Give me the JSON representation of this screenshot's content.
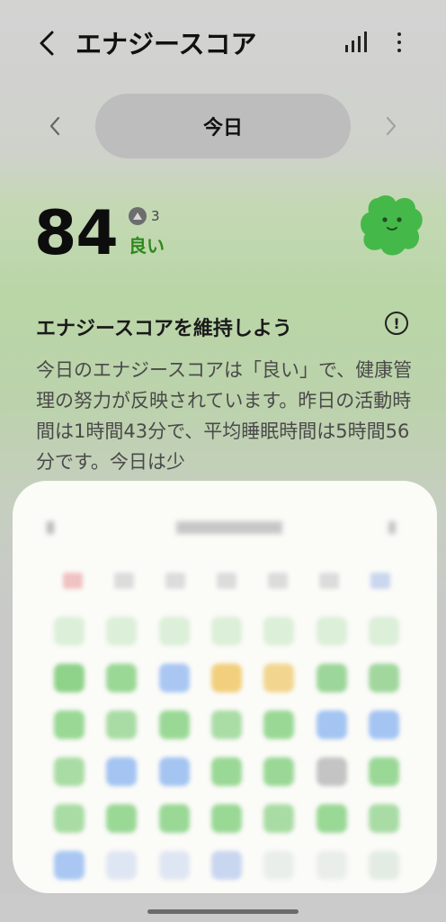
{
  "header": {
    "title": "エナジースコア"
  },
  "date_nav": {
    "label": "今日"
  },
  "score": {
    "value": "84",
    "delta": "3",
    "status": "良い",
    "status_color": "#2c8a1c"
  },
  "insight": {
    "title": "エナジースコアを維持しよう",
    "info_symbol": "!",
    "text": "今日のエナジースコアは「良い」で、健康管理の努力が反映されています。昨日の活動時間は1時間43分で、平均睡眠時間は5時間56分です。今日は少"
  },
  "calendar": {
    "weekday_colors": [
      "#f0c2c2",
      "#dcdcdc",
      "#dcdcdc",
      "#dcdcdc",
      "#dcdcdc",
      "#dcdcdc",
      "#c9d6ee"
    ],
    "rows": [
      [
        "#dcefd8",
        "#dcefd8",
        "#dcefd8",
        "#dcefd8",
        "#dcefd8",
        "#dcefd8",
        "#dcefd8"
      ],
      [
        "#8fd28a",
        "#9ad896",
        "#a9c7f2",
        "#f2cf7c",
        "#f2d58e",
        "#9cd69a",
        "#a1d79d"
      ],
      [
        "#9ad896",
        "#a9dca4",
        "#9ad896",
        "#aadca6",
        "#9ad896",
        "#a4c4f2",
        "#a4c4f2"
      ],
      [
        "#a9dca4",
        "#a4c4f2",
        "#a4c4f2",
        "#9ad896",
        "#9ad896",
        "#c4c4c4",
        "#9ad896"
      ],
      [
        "#a9dca4",
        "#9ad896",
        "#9ad896",
        "#9ad896",
        "#a9dca4",
        "#9ad896",
        "#a9dca4"
      ],
      [
        "#a9c7f2",
        "#dfe6f3",
        "#dfe6f3",
        "#c8d6f0",
        "#eaeeea",
        "#eaeeea",
        "#e3ece3"
      ]
    ]
  }
}
